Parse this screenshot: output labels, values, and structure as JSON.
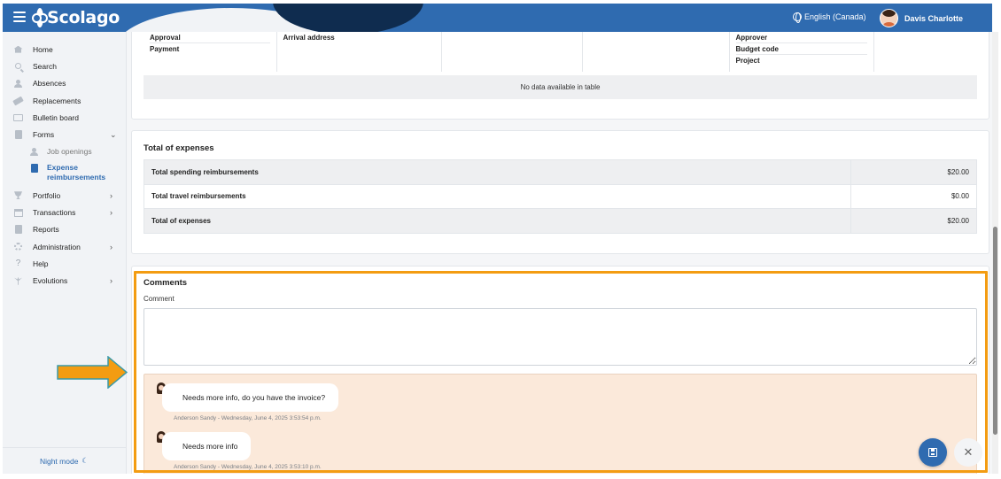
{
  "app": {
    "name": "Scolago"
  },
  "header": {
    "language": "English (Canada)",
    "user_name": "Davis Charlotte"
  },
  "sidebar": {
    "items": [
      {
        "label": "Home",
        "icon": "home-icon"
      },
      {
        "label": "Search",
        "icon": "search-icon"
      },
      {
        "label": "Absences",
        "icon": "absences-icon"
      },
      {
        "label": "Replacements",
        "icon": "replacements-icon"
      },
      {
        "label": "Bulletin board",
        "icon": "bulletin-board-icon"
      },
      {
        "label": "Forms",
        "icon": "forms-icon",
        "expanded": true
      },
      {
        "label": "Job openings",
        "icon": "job-openings-icon"
      },
      {
        "label": "Expense reimbursements",
        "icon": "expense-icon",
        "active": true
      },
      {
        "label": "Portfolio",
        "icon": "portfolio-icon"
      },
      {
        "label": "Transactions",
        "icon": "transactions-icon"
      },
      {
        "label": "Reports",
        "icon": "reports-icon"
      },
      {
        "label": "Administration",
        "icon": "administration-icon"
      },
      {
        "label": "Help",
        "icon": "help-icon"
      },
      {
        "label": "Evolutions",
        "icon": "evolutions-icon"
      }
    ],
    "night_mode": "Night mode"
  },
  "details_table": {
    "col1": [
      "Approval",
      "Payment"
    ],
    "col2": "Arrival address",
    "col5": [
      "Approver",
      "Budget code",
      "Project"
    ],
    "empty_message": "No data available in table"
  },
  "expenses": {
    "title": "Total of expenses",
    "rows": [
      {
        "label": "Total spending reimbursements",
        "amount": "$20.00"
      },
      {
        "label": "Total travel reimbursements",
        "amount": "$0.00"
      },
      {
        "label": "Total of expenses",
        "amount": "$20.00"
      }
    ]
  },
  "comments": {
    "title": "Comments",
    "field_label": "Comment",
    "messages": [
      {
        "text": "Needs more info, do you have the invoice?",
        "meta": "Anderson Sandy - Wednesday, June 4, 2025 3:53:54 p.m."
      },
      {
        "text": "Needs more info",
        "meta": "Anderson Sandy - Wednesday, June 4, 2025 3:53:10 p.m."
      }
    ]
  },
  "colors": {
    "primary": "#2f6bb0",
    "highlight": "#f39c12",
    "thread_bg": "#fbe9da",
    "online": "#1aa37a"
  }
}
